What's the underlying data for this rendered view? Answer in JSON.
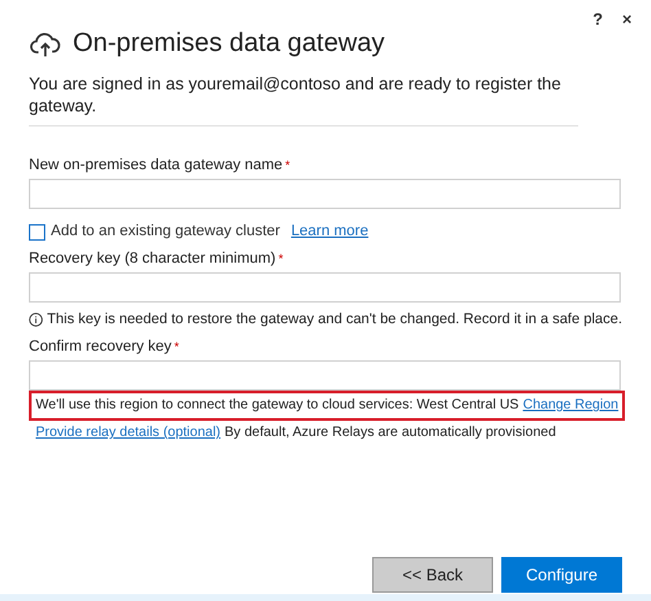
{
  "window": {
    "help": "?",
    "close": "×",
    "title": "On-premises data gateway"
  },
  "intro": "You are signed in as youremail@contoso and are ready to register the gateway.",
  "name_field": {
    "label": "New on-premises data gateway name",
    "required": "*"
  },
  "cluster": {
    "label": "Add to an existing gateway cluster",
    "checked": false,
    "link": "Learn more"
  },
  "recovery_field": {
    "label": "Recovery key (8 character minimum)",
    "required": "*"
  },
  "info": "This key is needed to restore the gateway and can't be changed. Record it in a safe place.",
  "confirm_field": {
    "label": "Confirm recovery key",
    "required": "*"
  },
  "region": {
    "text": "We'll use this region to connect the gateway to cloud services: West Central US",
    "link": "Change Region",
    "highlighted": true
  },
  "relay": {
    "link": "Provide relay details (optional)",
    "text": "By default, Azure Relays are automatically provisioned"
  },
  "buttons": [
    {
      "label": "<< Back",
      "kind": "secondary"
    },
    {
      "label": "Configure",
      "kind": "primary"
    }
  ]
}
